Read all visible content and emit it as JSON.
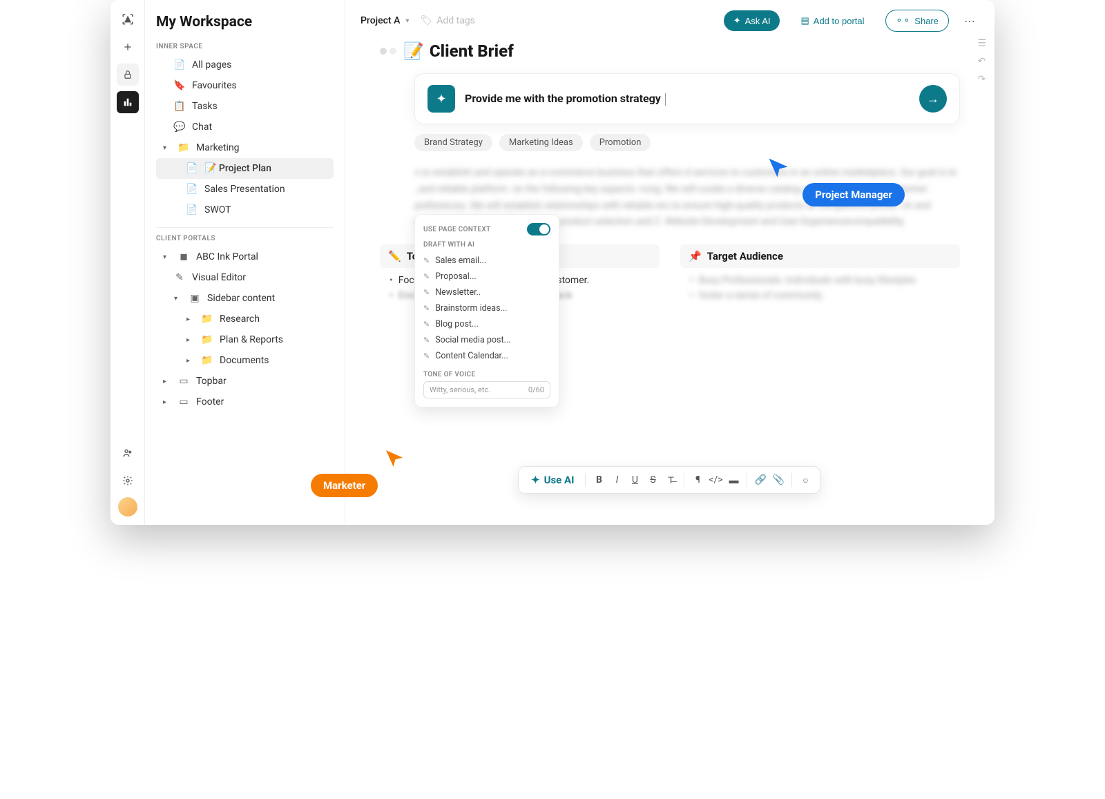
{
  "rail": {
    "items": [
      "target",
      "plus",
      "lock",
      "chart"
    ]
  },
  "sidebar": {
    "workspace_title": "My Workspace",
    "section_inner": "INNER SPACE",
    "items": [
      {
        "icon": "doc",
        "label": "All pages"
      },
      {
        "icon": "bookmark",
        "label": "Favourites"
      },
      {
        "icon": "list",
        "label": "Tasks"
      },
      {
        "icon": "chat",
        "label": "Chat"
      },
      {
        "icon": "folder",
        "label": "Marketing",
        "expandable": true
      },
      {
        "icon": "doc",
        "label": "📝 Project Plan",
        "active": true
      },
      {
        "icon": "doc",
        "label": "Sales Presentation"
      },
      {
        "icon": "doc",
        "label": "SWOT"
      }
    ],
    "section_portals": "CLIENT PORTALS",
    "portal_items": [
      {
        "icon": "square",
        "label": "ABC Ink Portal",
        "expandable": true
      },
      {
        "icon": "pencil",
        "label": "Visual Editor"
      },
      {
        "icon": "layout",
        "label": "Sidebar content",
        "expandable": true
      },
      {
        "icon": "folder",
        "label": "Research"
      },
      {
        "icon": "folder",
        "label": "Plan & Reports"
      },
      {
        "icon": "folder",
        "label": "Documents"
      },
      {
        "icon": "box",
        "label": "Topbar"
      },
      {
        "icon": "box",
        "label": "Footer"
      }
    ]
  },
  "topbar": {
    "project": "Project A",
    "add_tags": "Add tags",
    "ask_ai": "Ask AI",
    "add_portal": "Add to portal",
    "share": "Share"
  },
  "doc": {
    "title": "Client Brief",
    "title_icon": "📝",
    "ai_prompt": "Provide me with the promotion strategy",
    "chips": [
      "Brand Strategy",
      "Marketing Ideas",
      "Promotion"
    ]
  },
  "ai_panel": {
    "context_label": "USE PAGE CONTEXT",
    "draft_label": "DRAFT WITH AI",
    "items": [
      "Sales email...",
      "Proposal...",
      "Newsletter..",
      "Brainstorm ideas...",
      "Blog post...",
      "Social media post...",
      "Content Calendar..."
    ],
    "tone_label": "TONE OF VOICE",
    "tone_placeholder": "Witty, serious, etc.",
    "tone_counter": "0/60"
  },
  "blur_paragraph": "s to establish and operate an e-commerce business that offers d services to customers in an online marketplace. Our goal is to , and reliable platform. on the following key aspects: rcing: We will curate a diverse catalog of products that align stomer preferences. We will establish relationships with reliable ers to ensure high-quality products at competitive prices. ch and customer feedback will guide our product selection and 2. Website Development and User Experiencecompatibility.",
  "cols": {
    "left": {
      "icon": "✏️",
      "title": "Ton Of Voice",
      "bullets": [
        "Focus on building credibility in the customer.",
        "Encourage customer customer feedback"
      ]
    },
    "right": {
      "icon": "📌",
      "title": "Target Audience",
      "bullets": [
        "Busy Professionals: Individuals with busy lifestyles",
        "foster a sense of community."
      ]
    }
  },
  "toolbar": {
    "use_ai": "Use AI"
  },
  "badges": {
    "pm": "Project Manager",
    "mk": "Marketer"
  }
}
